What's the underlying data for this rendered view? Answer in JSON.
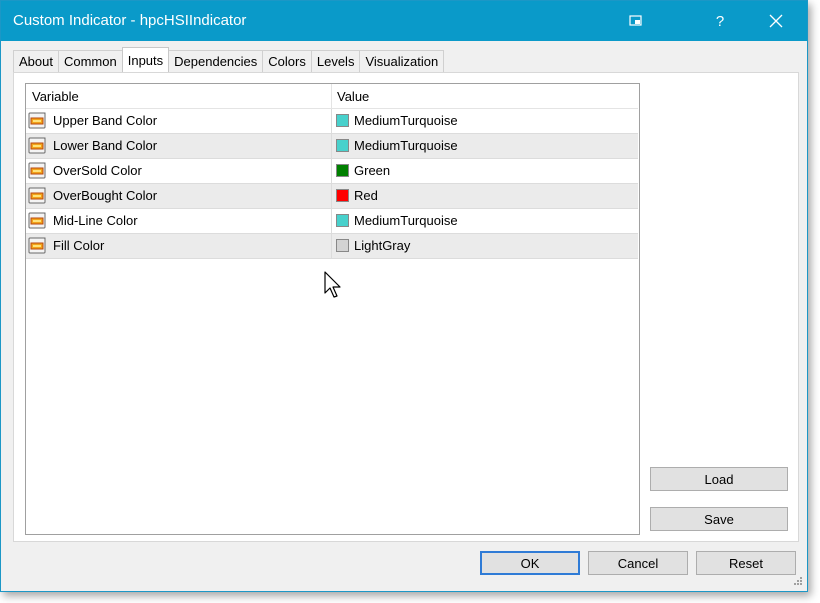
{
  "window": {
    "title": "Custom Indicator - hpcHSIIndicator",
    "help_label": "?"
  },
  "tabs": [
    {
      "label": "About",
      "active": false
    },
    {
      "label": "Common",
      "active": false
    },
    {
      "label": "Inputs",
      "active": true
    },
    {
      "label": "Dependencies",
      "active": false
    },
    {
      "label": "Colors",
      "active": false
    },
    {
      "label": "Levels",
      "active": false
    },
    {
      "label": "Visualization",
      "active": false
    }
  ],
  "grid": {
    "columns": [
      "Variable",
      "Value"
    ],
    "rows": [
      {
        "variable": "Upper Band Color",
        "value": "MediumTurquoise",
        "color": "#48d1cc"
      },
      {
        "variable": "Lower Band Color",
        "value": "MediumTurquoise",
        "color": "#48d1cc"
      },
      {
        "variable": "OverSold Color",
        "value": "Green",
        "color": "#008000"
      },
      {
        "variable": "OverBought Color",
        "value": "Red",
        "color": "#ff0000"
      },
      {
        "variable": "Mid-Line Color",
        "value": "MediumTurquoise",
        "color": "#48d1cc"
      },
      {
        "variable": "Fill Color",
        "value": "LightGray",
        "color": "#d3d3d3"
      }
    ]
  },
  "side_buttons": {
    "load": "Load",
    "save": "Save"
  },
  "footer_buttons": {
    "ok": "OK",
    "cancel": "Cancel",
    "reset": "Reset"
  },
  "colors": {
    "titlebar": "#0a9ac9",
    "accent": "#2f7bd6"
  }
}
